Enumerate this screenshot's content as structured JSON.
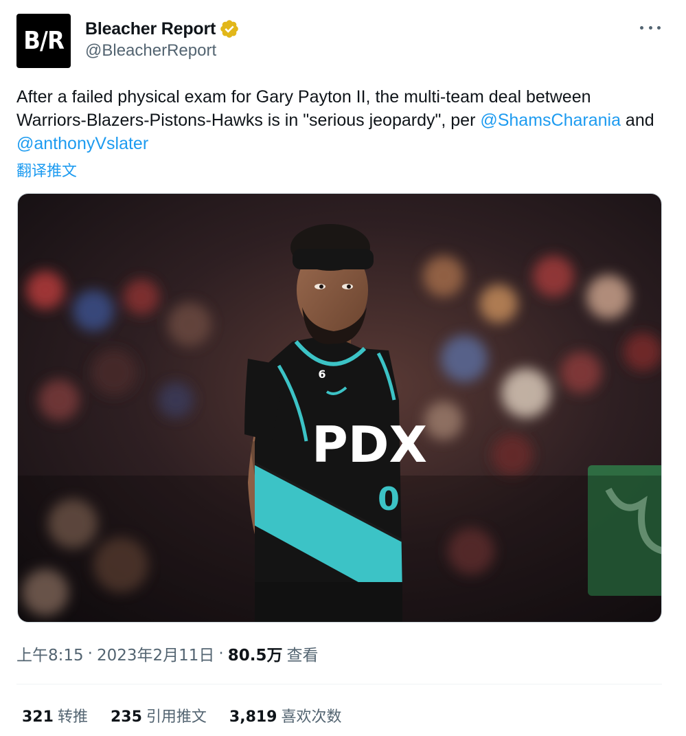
{
  "account": {
    "avatar_text": "B/R",
    "display_name": "Bleacher Report",
    "handle": "@BleacherReport",
    "verified_icon": "gold-verified-badge",
    "verified_color": "#e2b719"
  },
  "tweet": {
    "text_before": "After a failed physical exam for Gary Payton II, the multi-team deal between Warriors-Blazers-Pistons-Hawks is in \"serious jeopardy\", per ",
    "mention_1": "@ShamsCharania",
    "connector": " and ",
    "mention_2": "@anthonyVslater",
    "translate_label": "翻译推文"
  },
  "media": {
    "jersey_text": "PDX",
    "jersey_number": "0",
    "jersey_shoulder_number": "6"
  },
  "meta": {
    "time": "上午8:15",
    "separator": "·",
    "date": "2023年2月11日",
    "views": "80.5万",
    "views_label": "查看"
  },
  "stats": [
    {
      "count": "321",
      "label": "转推"
    },
    {
      "count": "235",
      "label": "引用推文"
    },
    {
      "count": "3,819",
      "label": "喜欢次数"
    }
  ],
  "colors": {
    "link": "#1d9bf0",
    "secondary_text": "#536471",
    "primary_text": "#0f1419",
    "jersey_teal": "#3cc3c6"
  }
}
